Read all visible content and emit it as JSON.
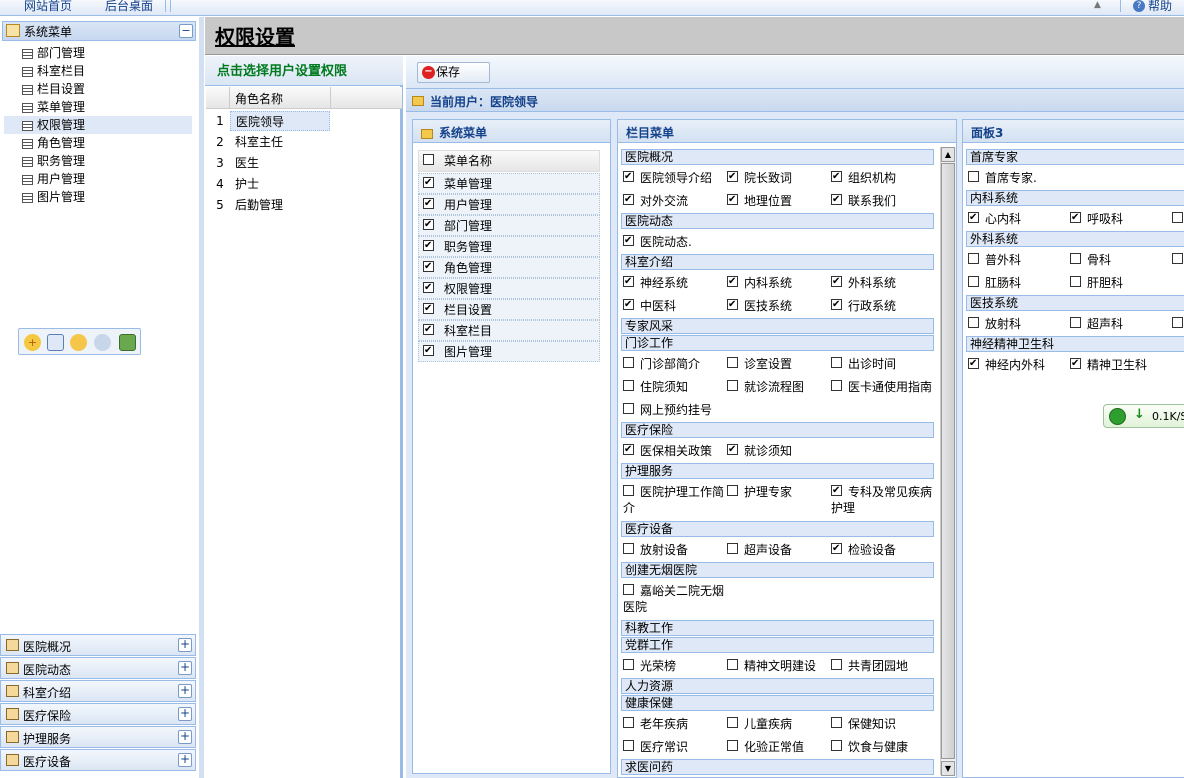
{
  "topbar": {
    "home": "网站首页",
    "desktop": "后台桌面",
    "help": "帮助",
    "up_arrow": "▲"
  },
  "left": {
    "title": "系统菜单",
    "collapse": "−",
    "items": [
      "部门管理",
      "科室栏目",
      "栏目设置",
      "菜单管理",
      "权限管理",
      "角色管理",
      "职务管理",
      "用户管理",
      "图片管理"
    ],
    "selected_index": 4,
    "toolbox_icons": [
      "add-icon",
      "save-icon",
      "edit-icon",
      "search-user-icon",
      "export-icon"
    ],
    "accordion": [
      "医院概况",
      "医院动态",
      "科室介绍",
      "医疗保险",
      "护理服务",
      "医疗设备"
    ],
    "plus": "+"
  },
  "main": {
    "title": "权限设置"
  },
  "roles": {
    "header": "点击选择用户设置权限",
    "column": "角色名称",
    "rows": [
      {
        "n": "1",
        "name": "医院领导"
      },
      {
        "n": "2",
        "name": "科室主任"
      },
      {
        "n": "3",
        "name": "医生"
      },
      {
        "n": "4",
        "name": "护士"
      },
      {
        "n": "5",
        "name": "后勤管理"
      }
    ],
    "selected_index": 0
  },
  "toolbar": {
    "save": "保存",
    "stop_glyph": "−"
  },
  "current_user": "当前用户：医院领导",
  "system_menu": {
    "title": "系统菜单",
    "column": "菜单名称",
    "items": [
      "菜单管理",
      "用户管理",
      "部门管理",
      "职务管理",
      "角色管理",
      "权限管理",
      "栏目设置",
      "科室栏目",
      "图片管理"
    ]
  },
  "column_menu": {
    "title": "栏目菜单",
    "sections": [
      {
        "t": "医院概况"
      },
      {
        "c": [
          [
            "医院领导介绍",
            true
          ],
          [
            "院长致词",
            true
          ],
          [
            "组织机构",
            true
          ]
        ]
      },
      {
        "c": [
          [
            "对外交流",
            true
          ],
          [
            "地理位置",
            true
          ],
          [
            "联系我们",
            true
          ]
        ]
      },
      {
        "t": "医院动态"
      },
      {
        "c": [
          [
            "医院动态.",
            true
          ]
        ]
      },
      {
        "t": "科室介绍"
      },
      {
        "c": [
          [
            "神经系统",
            true
          ],
          [
            "内科系统",
            true
          ],
          [
            "外科系统",
            true
          ]
        ]
      },
      {
        "c": [
          [
            "中医科",
            true
          ],
          [
            "医技系统",
            true
          ],
          [
            "行政系统",
            true
          ]
        ]
      },
      {
        "t": "专家风采"
      },
      {
        "t": "门诊工作"
      },
      {
        "c": [
          [
            "门诊部简介",
            false
          ],
          [
            "诊室设置",
            false
          ],
          [
            "出诊时间",
            false
          ]
        ]
      },
      {
        "c": [
          [
            "住院须知",
            false
          ],
          [
            "就诊流程图",
            false
          ],
          [
            "医卡通使用指南",
            false
          ]
        ]
      },
      {
        "c": [
          [
            "网上预约挂号",
            false
          ]
        ]
      },
      {
        "t": "医疗保险"
      },
      {
        "c": [
          [
            "医保相关政策",
            true
          ],
          [
            "就诊须知",
            true
          ]
        ]
      },
      {
        "t": "护理服务"
      },
      {
        "c": [
          [
            "医院护理工作简介",
            false
          ],
          [
            "护理专家",
            false
          ],
          [
            "专科及常见疾病护理",
            true
          ]
        ],
        "wrap": true
      },
      {
        "t": "医疗设备"
      },
      {
        "c": [
          [
            "放射设备",
            false
          ],
          [
            "超声设备",
            false
          ],
          [
            "检验设备",
            true
          ]
        ]
      },
      {
        "t": "创建无烟医院"
      },
      {
        "c": [
          [
            "嘉峪关二院无烟医院",
            false
          ]
        ],
        "wrap": true
      },
      {
        "t": "科教工作"
      },
      {
        "t": "党群工作"
      },
      {
        "c": [
          [
            "光荣榜",
            false
          ],
          [
            "精神文明建设",
            false
          ],
          [
            "共青团园地",
            false
          ]
        ]
      },
      {
        "t": "人力资源"
      },
      {
        "t": "健康保健"
      },
      {
        "c": [
          [
            "老年疾病",
            false
          ],
          [
            "儿童疾病",
            false
          ],
          [
            "保健知识",
            false
          ]
        ]
      },
      {
        "c": [
          [
            "医疗常识",
            false
          ],
          [
            "化验正常值",
            false
          ],
          [
            "饮食与健康",
            false
          ]
        ]
      },
      {
        "t": "求医问药"
      }
    ]
  },
  "panel3": {
    "title": "面板3",
    "sections": [
      {
        "t": "首席专家"
      },
      {
        "c": [
          [
            "首席专家.",
            false
          ]
        ]
      },
      {
        "t": "内科系统"
      },
      {
        "c": [
          [
            "心内科",
            true
          ],
          [
            "呼吸科",
            true
          ],
          [
            "",
            false
          ]
        ]
      },
      {
        "t": "外科系统"
      },
      {
        "c": [
          [
            "普外科",
            false
          ],
          [
            "骨科",
            false
          ],
          [
            "",
            false
          ]
        ]
      },
      {
        "c": [
          [
            "肛肠科",
            false
          ],
          [
            "肝胆科",
            false
          ]
        ]
      },
      {
        "t": "医技系统"
      },
      {
        "c": [
          [
            "放射科",
            false
          ],
          [
            "超声科",
            false
          ],
          [
            "",
            false
          ]
        ]
      },
      {
        "t": "神经精神卫生科"
      },
      {
        "c": [
          [
            "神经内外科",
            true
          ],
          [
            "精神卫生科",
            true
          ]
        ]
      }
    ]
  },
  "net_widget": {
    "speed": "0.1K/S",
    "arrow": "↓"
  }
}
